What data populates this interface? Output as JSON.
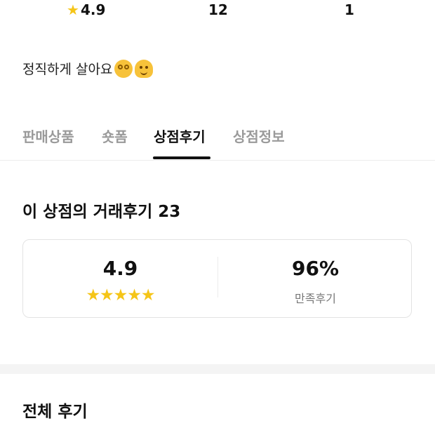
{
  "stats": {
    "rating": "4.9",
    "rating_icon": "star-icon",
    "second": "12",
    "third": "1"
  },
  "bio": {
    "text": "정직하게 살아요",
    "emojis": [
      "spiral-eyes-face-icon",
      "melting-face-icon"
    ]
  },
  "tabs": [
    {
      "label": "판매상품",
      "active": false
    },
    {
      "label": "숏폼",
      "active": false
    },
    {
      "label": "상점후기",
      "active": true
    },
    {
      "label": "상점정보",
      "active": false
    }
  ],
  "review_section": {
    "title": "이 상점의 거래후기 23"
  },
  "summary": {
    "rating_value": "4.9",
    "stars": "★★★★★",
    "star_count": 5,
    "satisfaction_value": "96%",
    "satisfaction_label": "만족후기"
  },
  "all_reviews": {
    "title": "전체 후기"
  },
  "colors": {
    "accent_star": "#f5c518",
    "active_tab": "#111111",
    "inactive_tab": "#9a9a9a",
    "divider": "#f4f4f4"
  }
}
